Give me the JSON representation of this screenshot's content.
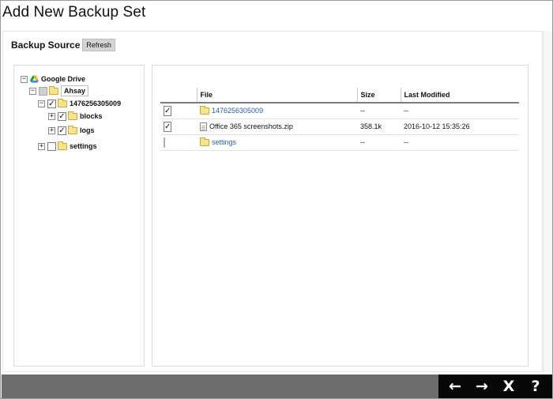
{
  "window": {
    "title": "Add New Backup Set"
  },
  "section": {
    "title": "Backup Source",
    "refresh_label": "Refresh"
  },
  "tree": {
    "root": {
      "label": "Google Drive",
      "expand": "−"
    },
    "user": {
      "label": "Ahsay",
      "expand": "−",
      "check": ""
    },
    "folder": {
      "label": "1476256305009",
      "expand": "−",
      "check": "✓"
    },
    "blocks": {
      "label": "blocks",
      "expand": "+",
      "check": "✓"
    },
    "logs": {
      "label": "logs",
      "expand": "+",
      "check": "✓"
    },
    "settings": {
      "label": "settings",
      "expand": "+",
      "check": ""
    }
  },
  "table": {
    "columns": {
      "file": "File",
      "size": "Size",
      "modified": "Last Modified"
    },
    "rows": [
      {
        "check": "✓",
        "name": "1476256305009",
        "size": "--",
        "modified": "--"
      },
      {
        "check": "✓",
        "name": "Office 365 screenshots.zip",
        "size": "358.1k",
        "modified": "2016-10-12 15:35:26"
      },
      {
        "check": "",
        "name": "settings",
        "size": "--",
        "modified": "--"
      }
    ]
  },
  "nav": {
    "back": "←",
    "next": "→",
    "close": "X",
    "help": "?"
  },
  "colors": {
    "link": "#2463ac",
    "folder": "#f5e48c",
    "bottom_bar": "#6c6c6c",
    "nav_bg": "#080808"
  }
}
